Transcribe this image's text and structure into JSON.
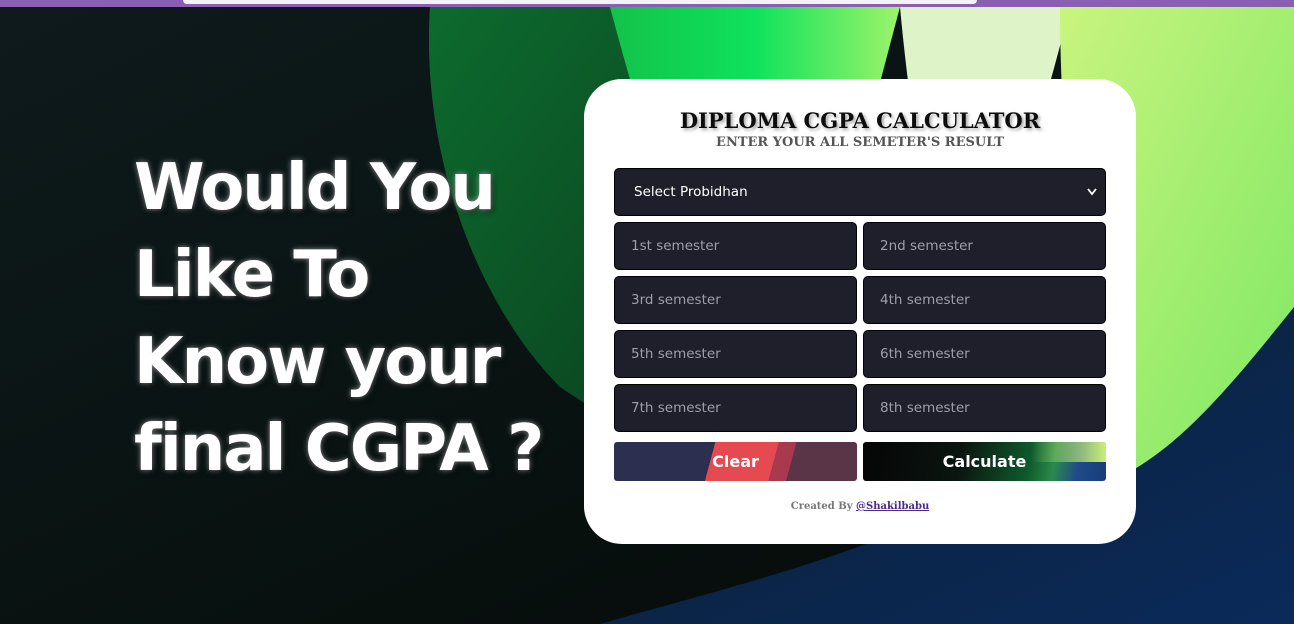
{
  "hero": {
    "lines": [
      "Would You",
      "Like To",
      "Know your",
      "final CGPA ?"
    ]
  },
  "card": {
    "title": "DIPLOMA CGPA CALCULATOR",
    "subtitle": "ENTER YOUR ALL SEMETER'S RESULT",
    "select_value": "Select Probidhan",
    "fields": [
      "1st semester",
      "2nd semester",
      "3rd semester",
      "4th semester",
      "5th semester",
      "6th semester",
      "7th semester",
      "8th semester"
    ],
    "clear_label": "Clear",
    "calculate_label": "Calculate",
    "credit_prefix": "Created By",
    "credit_link": "@Shakilbabu"
  },
  "colors": {
    "card_bg": "#ffffff",
    "field_bg": "#1e1f2b",
    "topbar": "#8a5fb3"
  },
  "icons": [
    "chevron-down-icon"
  ]
}
